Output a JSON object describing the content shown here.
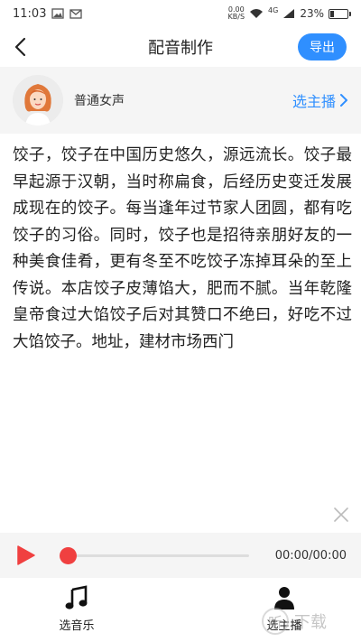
{
  "status_bar": {
    "time": "11:03",
    "netspeed_value": "0.00",
    "netspeed_unit": "KB/S",
    "signal_type": "4G",
    "battery_level": 0.23,
    "battery_text": "23%"
  },
  "header": {
    "title": "配音制作",
    "export_label": "导出"
  },
  "voice": {
    "name": "普通女声",
    "select_label": "选主播"
  },
  "script_text": "饺子，饺子在中国历史悠久，源远流长。饺子最早起源于汉朝，当时称扁食，后经历史变迁发展成现在的饺子。每当逢年过节家人团圆，都有吃饺子的习俗。同时，饺子也是招待亲朋好友的一种美食佳肴，更有冬至不吃饺子冻掉耳朵的至上传说。本店饺子皮薄馅大，肥而不腻。当年乾隆皇帝食过大馅饺子后对其赞口不绝曰，好吃不过大馅饺子。地址，建材市场西门",
  "player": {
    "time": "00:00/00:00",
    "progress": 0,
    "accent_color": "#f04040"
  },
  "bottom_nav": {
    "music_label": "选音乐",
    "anchor_label": "选主播"
  },
  "watermark": {
    "circle_char": "听",
    "text": "下载"
  },
  "colors": {
    "accent_blue": "#2f8fff",
    "play_red": "#f04040"
  }
}
